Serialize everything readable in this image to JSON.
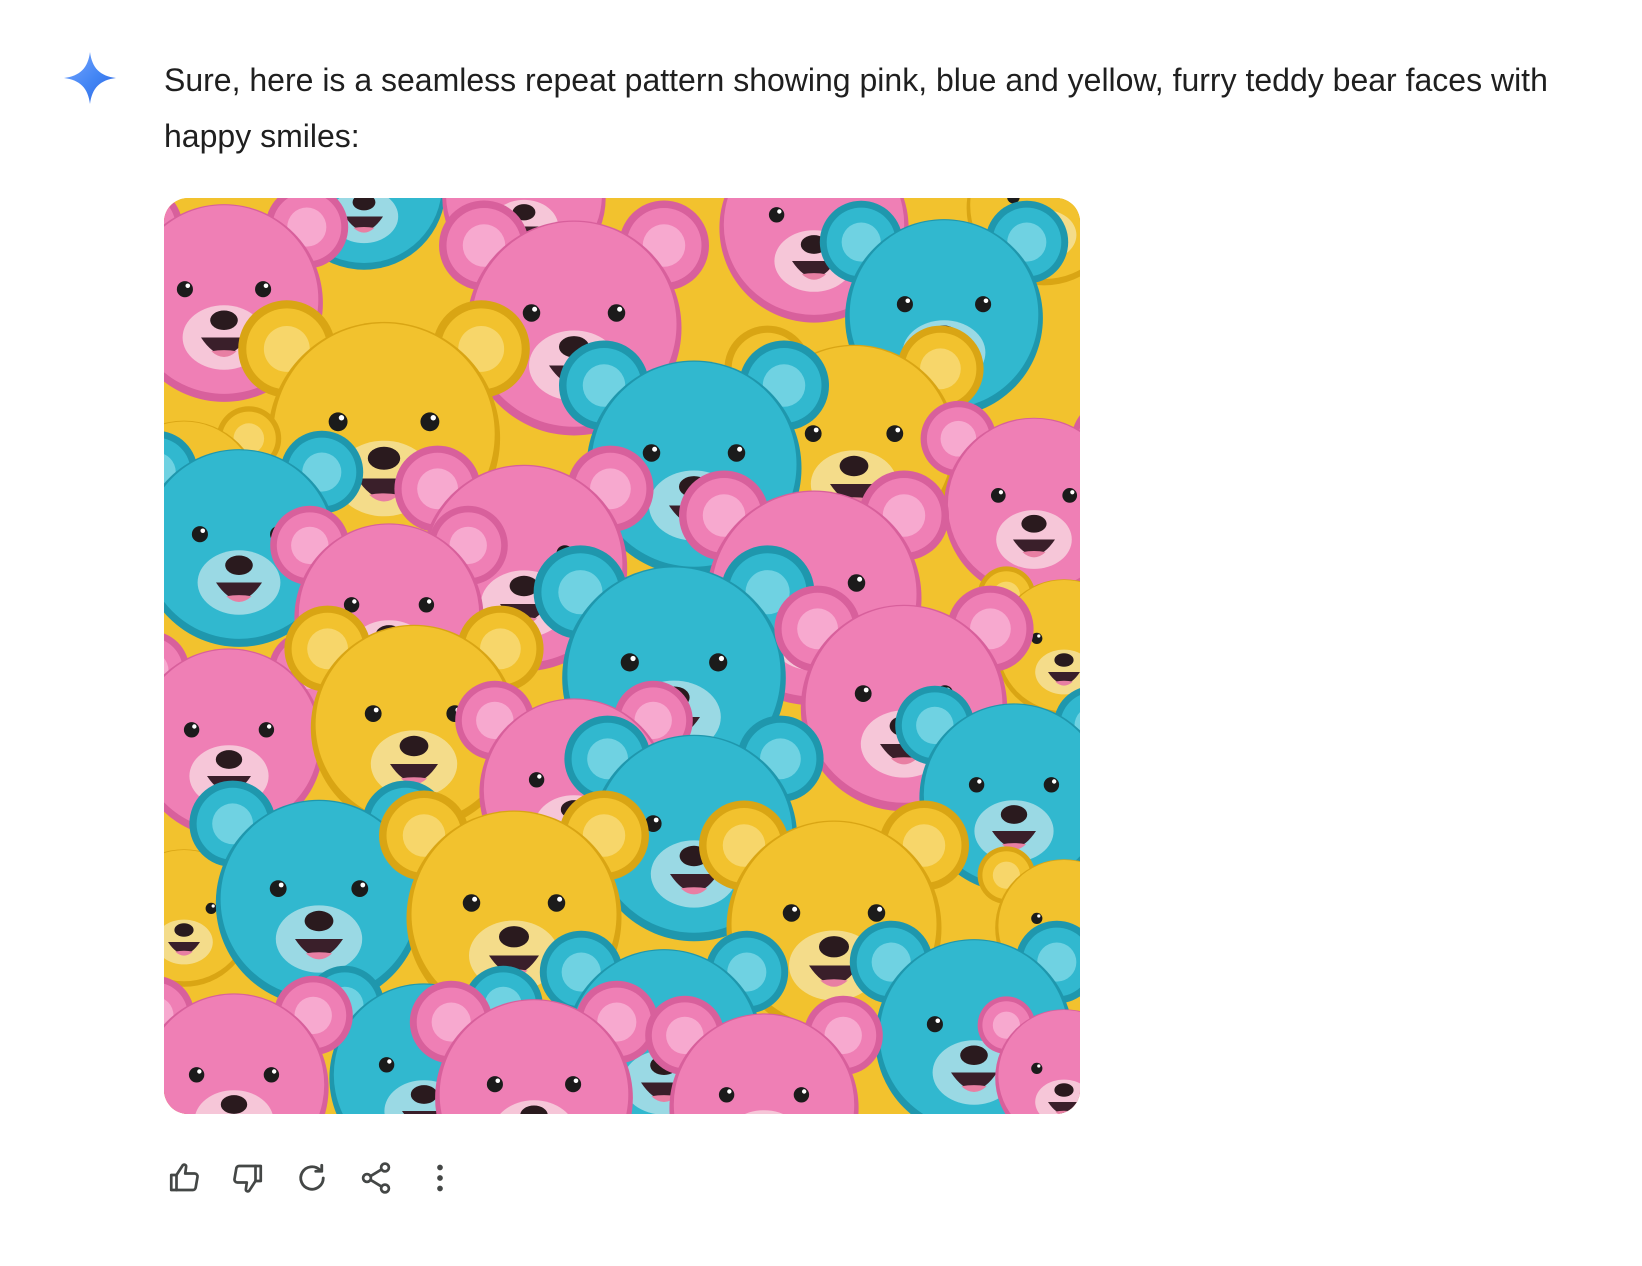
{
  "assistant": {
    "icon": "gemini-sparkle-icon",
    "message": "Sure, here is a seamless repeat pattern showing pink, blue and yellow, furry teddy bear faces with happy smiles:"
  },
  "generated_image": {
    "subject": "teddy-bear-pattern",
    "colors": {
      "pink": "#ef7fb5",
      "blue": "#31b8cf",
      "yellow": "#f2c22e",
      "background": "#f2c22e"
    }
  },
  "actions": [
    {
      "name": "thumbs-up-icon"
    },
    {
      "name": "thumbs-down-icon"
    },
    {
      "name": "regenerate-icon"
    },
    {
      "name": "share-icon"
    },
    {
      "name": "more-options-icon"
    }
  ],
  "theme": {
    "accent_blue": "#4285f4",
    "text": "#1f1f1f",
    "icon": "#444746"
  }
}
